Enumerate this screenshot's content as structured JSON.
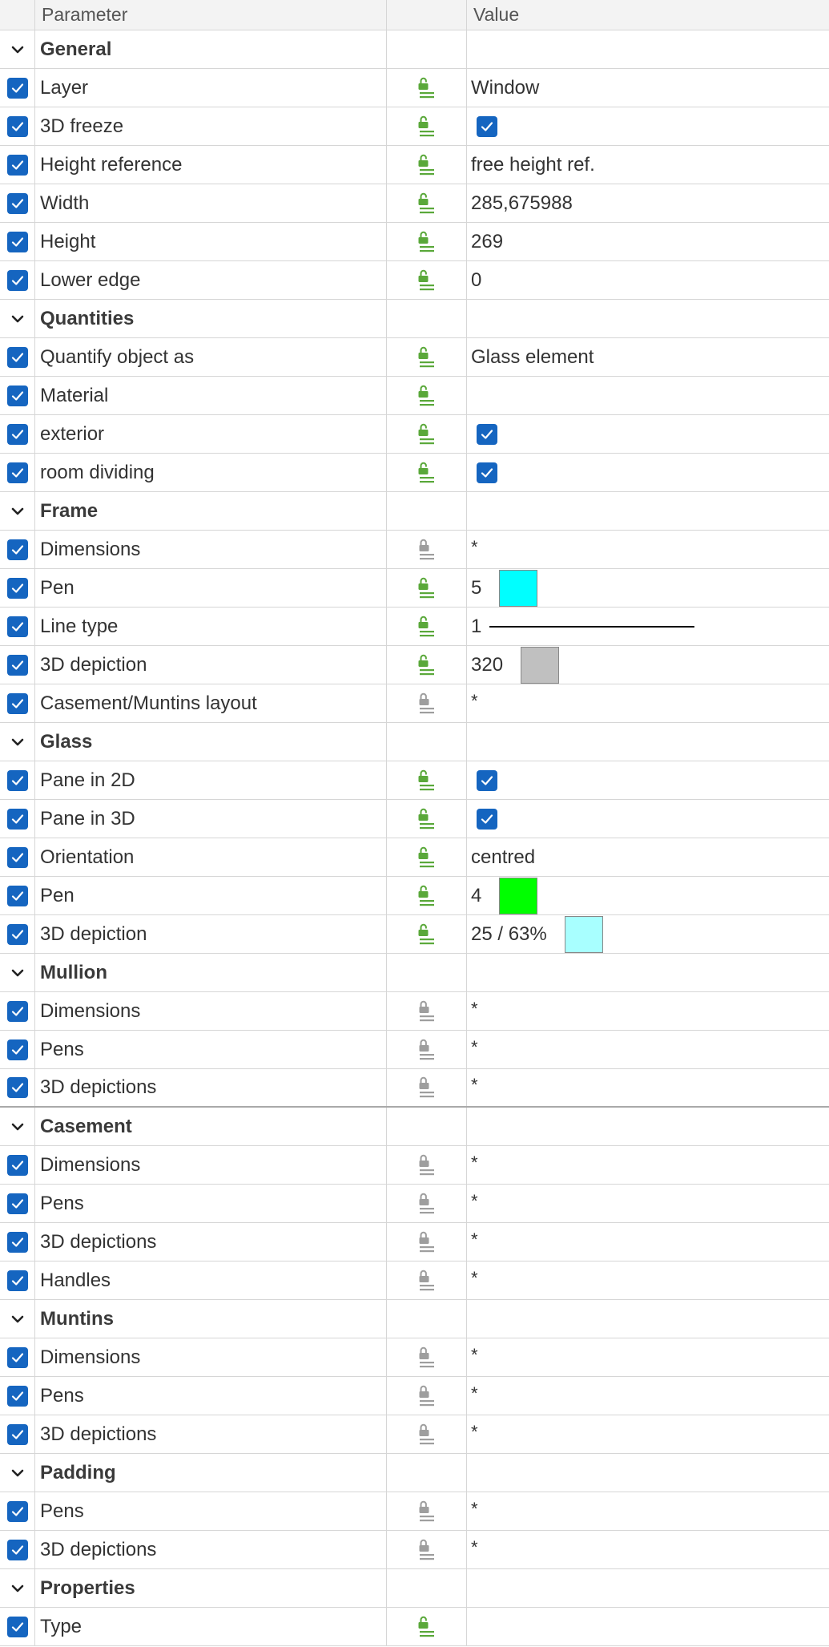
{
  "header": {
    "parameter": "Parameter",
    "value": "Value"
  },
  "colors": {
    "check": "#1565c0",
    "lock_open": "#5aa83a",
    "lock_closed": "#9e9e9e"
  },
  "rows": [
    {
      "kind": "group",
      "label": "General"
    },
    {
      "kind": "param",
      "label": "Layer",
      "lock": "open",
      "value": {
        "text": "Window"
      }
    },
    {
      "kind": "param",
      "label": "3D freeze",
      "lock": "open",
      "value": {
        "checkbox": true
      }
    },
    {
      "kind": "param",
      "label": "Height reference",
      "lock": "open",
      "value": {
        "text": "free height ref."
      }
    },
    {
      "kind": "param",
      "label": "Width",
      "lock": "open",
      "value": {
        "text": "285,675988"
      }
    },
    {
      "kind": "param",
      "label": "Height",
      "lock": "open",
      "value": {
        "text": "269"
      }
    },
    {
      "kind": "param",
      "label": "Lower edge",
      "lock": "open",
      "value": {
        "text": "0"
      }
    },
    {
      "kind": "group",
      "label": "Quantities"
    },
    {
      "kind": "param",
      "label": "Quantify object as",
      "lock": "open",
      "value": {
        "text": "Glass element"
      }
    },
    {
      "kind": "param",
      "label": "Material",
      "lock": "open",
      "value": {}
    },
    {
      "kind": "param",
      "label": "exterior",
      "lock": "open",
      "value": {
        "checkbox": true
      }
    },
    {
      "kind": "param",
      "label": "room dividing",
      "lock": "open",
      "value": {
        "checkbox": true
      }
    },
    {
      "kind": "group",
      "label": "Frame"
    },
    {
      "kind": "param",
      "label": "Dimensions",
      "lock": "closed",
      "value": {
        "star": "*"
      }
    },
    {
      "kind": "param",
      "label": "Pen",
      "lock": "open",
      "value": {
        "text": "5",
        "swatch": "#00ffff"
      }
    },
    {
      "kind": "param",
      "label": "Line type",
      "lock": "open",
      "value": {
        "text": "1",
        "line": true
      }
    },
    {
      "kind": "param",
      "label": "3D depiction",
      "lock": "open",
      "value": {
        "text": "320",
        "swatch": "#c0c0c0"
      }
    },
    {
      "kind": "param",
      "label": "Casement/Muntins layout",
      "lock": "closed",
      "value": {
        "star": "*"
      }
    },
    {
      "kind": "group",
      "label": "Glass"
    },
    {
      "kind": "param",
      "label": "Pane in 2D",
      "lock": "open",
      "value": {
        "checkbox": true
      }
    },
    {
      "kind": "param",
      "label": "Pane in 3D",
      "lock": "open",
      "value": {
        "checkbox": true
      }
    },
    {
      "kind": "param",
      "label": "Orientation",
      "lock": "open",
      "value": {
        "text": "centred"
      }
    },
    {
      "kind": "param",
      "label": "Pen",
      "lock": "open",
      "value": {
        "text": "4",
        "swatch": "#00ff00"
      }
    },
    {
      "kind": "param",
      "label": "3D depiction",
      "lock": "open",
      "value": {
        "text": "25 / 63%",
        "swatch": "#a8ffff"
      }
    },
    {
      "kind": "group",
      "label": "Mullion"
    },
    {
      "kind": "param",
      "label": "Dimensions",
      "lock": "closed",
      "value": {
        "star": "*"
      }
    },
    {
      "kind": "param",
      "label": "Pens",
      "lock": "closed",
      "value": {
        "star": "*"
      }
    },
    {
      "kind": "param",
      "label": "3D depictions",
      "lock": "closed",
      "value": {
        "star": "*"
      },
      "thick": true
    },
    {
      "kind": "group",
      "label": "Casement"
    },
    {
      "kind": "param",
      "label": "Dimensions",
      "lock": "closed",
      "value": {
        "star": "*"
      }
    },
    {
      "kind": "param",
      "label": "Pens",
      "lock": "closed",
      "value": {
        "star": "*"
      }
    },
    {
      "kind": "param",
      "label": "3D depictions",
      "lock": "closed",
      "value": {
        "star": "*"
      }
    },
    {
      "kind": "param",
      "label": "Handles",
      "lock": "closed",
      "value": {
        "star": "*"
      }
    },
    {
      "kind": "group",
      "label": "Muntins"
    },
    {
      "kind": "param",
      "label": "Dimensions",
      "lock": "closed",
      "value": {
        "star": "*"
      }
    },
    {
      "kind": "param",
      "label": "Pens",
      "lock": "closed",
      "value": {
        "star": "*"
      }
    },
    {
      "kind": "param",
      "label": "3D depictions",
      "lock": "closed",
      "value": {
        "star": "*"
      }
    },
    {
      "kind": "group",
      "label": "Padding"
    },
    {
      "kind": "param",
      "label": "Pens",
      "lock": "closed",
      "value": {
        "star": "*"
      }
    },
    {
      "kind": "param",
      "label": "3D depictions",
      "lock": "closed",
      "value": {
        "star": "*"
      }
    },
    {
      "kind": "group",
      "label": "Properties"
    },
    {
      "kind": "param",
      "label": "Type",
      "lock": "open",
      "value": {}
    }
  ]
}
